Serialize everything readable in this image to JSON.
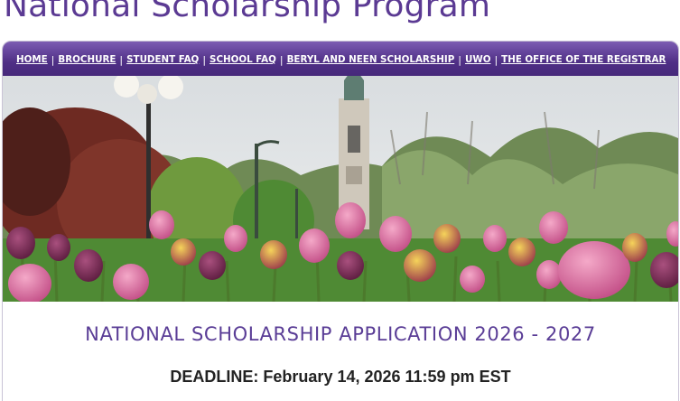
{
  "site": {
    "title": "National Scholarship Program"
  },
  "nav": {
    "items": [
      {
        "label": "HOME"
      },
      {
        "label": "BROCHURE"
      },
      {
        "label": "STUDENT FAQ"
      },
      {
        "label": "SCHOOL FAQ"
      },
      {
        "label": "BERYL AND NEEN SCHOLARSHIP"
      },
      {
        "label": "UWO"
      },
      {
        "label": "THE OFFICE OF THE REGISTRAR"
      }
    ],
    "separator": "|"
  },
  "hero": {
    "image_subject": "campus-tower-with-tulip-garden"
  },
  "main": {
    "heading": "NATIONAL SCHOLARSHIP APPLICATION 2026 - 2027",
    "deadline_label": "DEADLINE:",
    "deadline_value": "February 14, 2026 11:59 pm EST"
  },
  "colors": {
    "brand_purple": "#5b3a93",
    "nav_bg": "#4f2f86",
    "heading_purple": "#5a3d96"
  }
}
